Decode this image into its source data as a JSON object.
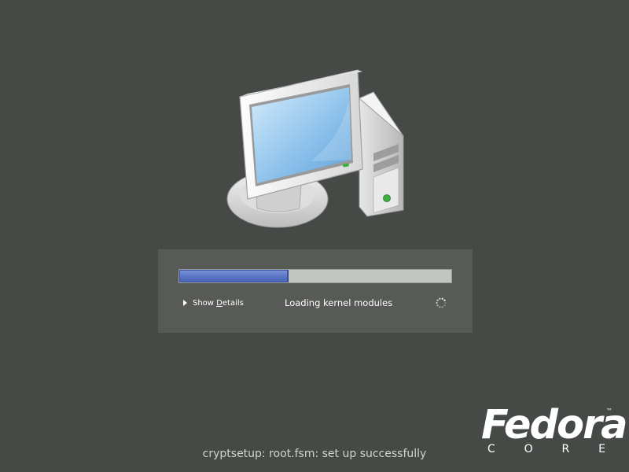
{
  "progress": {
    "fraction": 0.4
  },
  "details": {
    "label_before": "Show ",
    "label_accel": "D",
    "label_after": "etails"
  },
  "status": {
    "text": "Loading kernel modules"
  },
  "boot_message": "cryptsetup: root.fsm: set up successfully",
  "logo": {
    "word": "Fedora",
    "tm": "™",
    "sub_letters": [
      "C",
      "O",
      "R",
      "E"
    ]
  },
  "icons": {
    "computer": "computer-icon",
    "expander": "triangle-right-icon",
    "spinner": "spinner-icon"
  },
  "colors": {
    "background": "#464a46",
    "panel": "#575a56",
    "progress_fill": "#5d79c8",
    "progress_track": "#c3c5c1"
  }
}
